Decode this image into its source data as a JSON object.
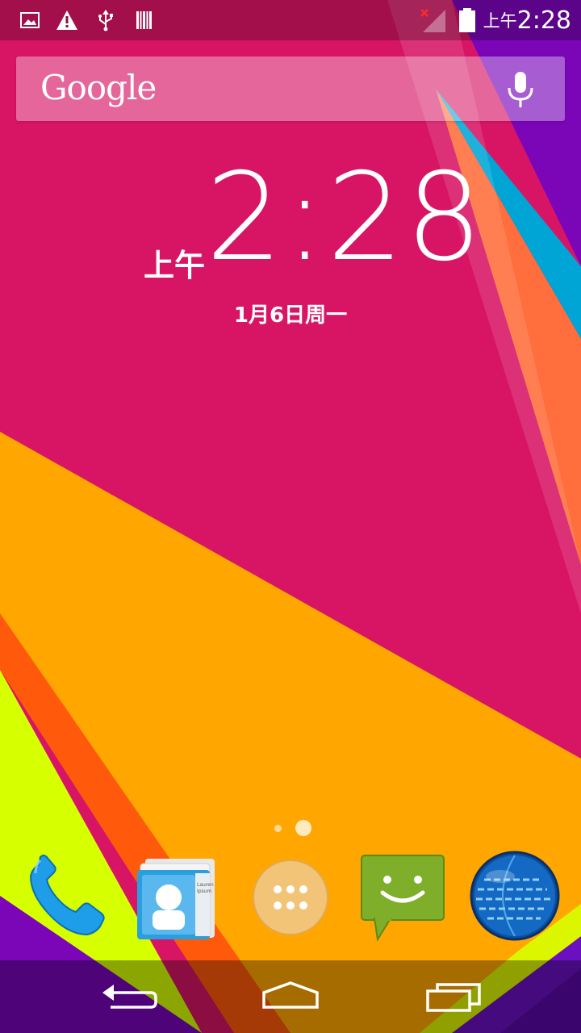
{
  "status_bar": {
    "time_ampm": "上午",
    "time": "2:28",
    "icons": [
      "gallery-icon",
      "warning-icon",
      "usb-icon",
      "barcode-icon",
      "signal-no-service-icon",
      "battery-icon"
    ]
  },
  "search": {
    "logo_text": "Google",
    "mic_icon": "microphone-icon"
  },
  "clock": {
    "ampm": "上午",
    "time": "2:28",
    "date": "1月6日周一"
  },
  "pages": {
    "count": 2,
    "current": 2
  },
  "dock": {
    "apps": [
      {
        "icon": "phone-icon"
      },
      {
        "icon": "contacts-icon",
        "card_text_line1": "Lauren",
        "card_text_line2": "Ipsum"
      },
      {
        "icon": "app-drawer-icon"
      },
      {
        "icon": "messaging-icon"
      },
      {
        "icon": "browser-globe-icon"
      }
    ]
  },
  "nav_bar": {
    "buttons": [
      "back-icon",
      "home-icon",
      "recents-icon"
    ]
  },
  "colors": {
    "wallpaper_magenta": "#d81565",
    "wallpaper_orange": "#ffa400",
    "wallpaper_red": "#ff4a0a",
    "wallpaper_lime": "#d8ff00",
    "wallpaper_purple": "#7a00b8",
    "wallpaper_cyan": "#00a8d8"
  }
}
